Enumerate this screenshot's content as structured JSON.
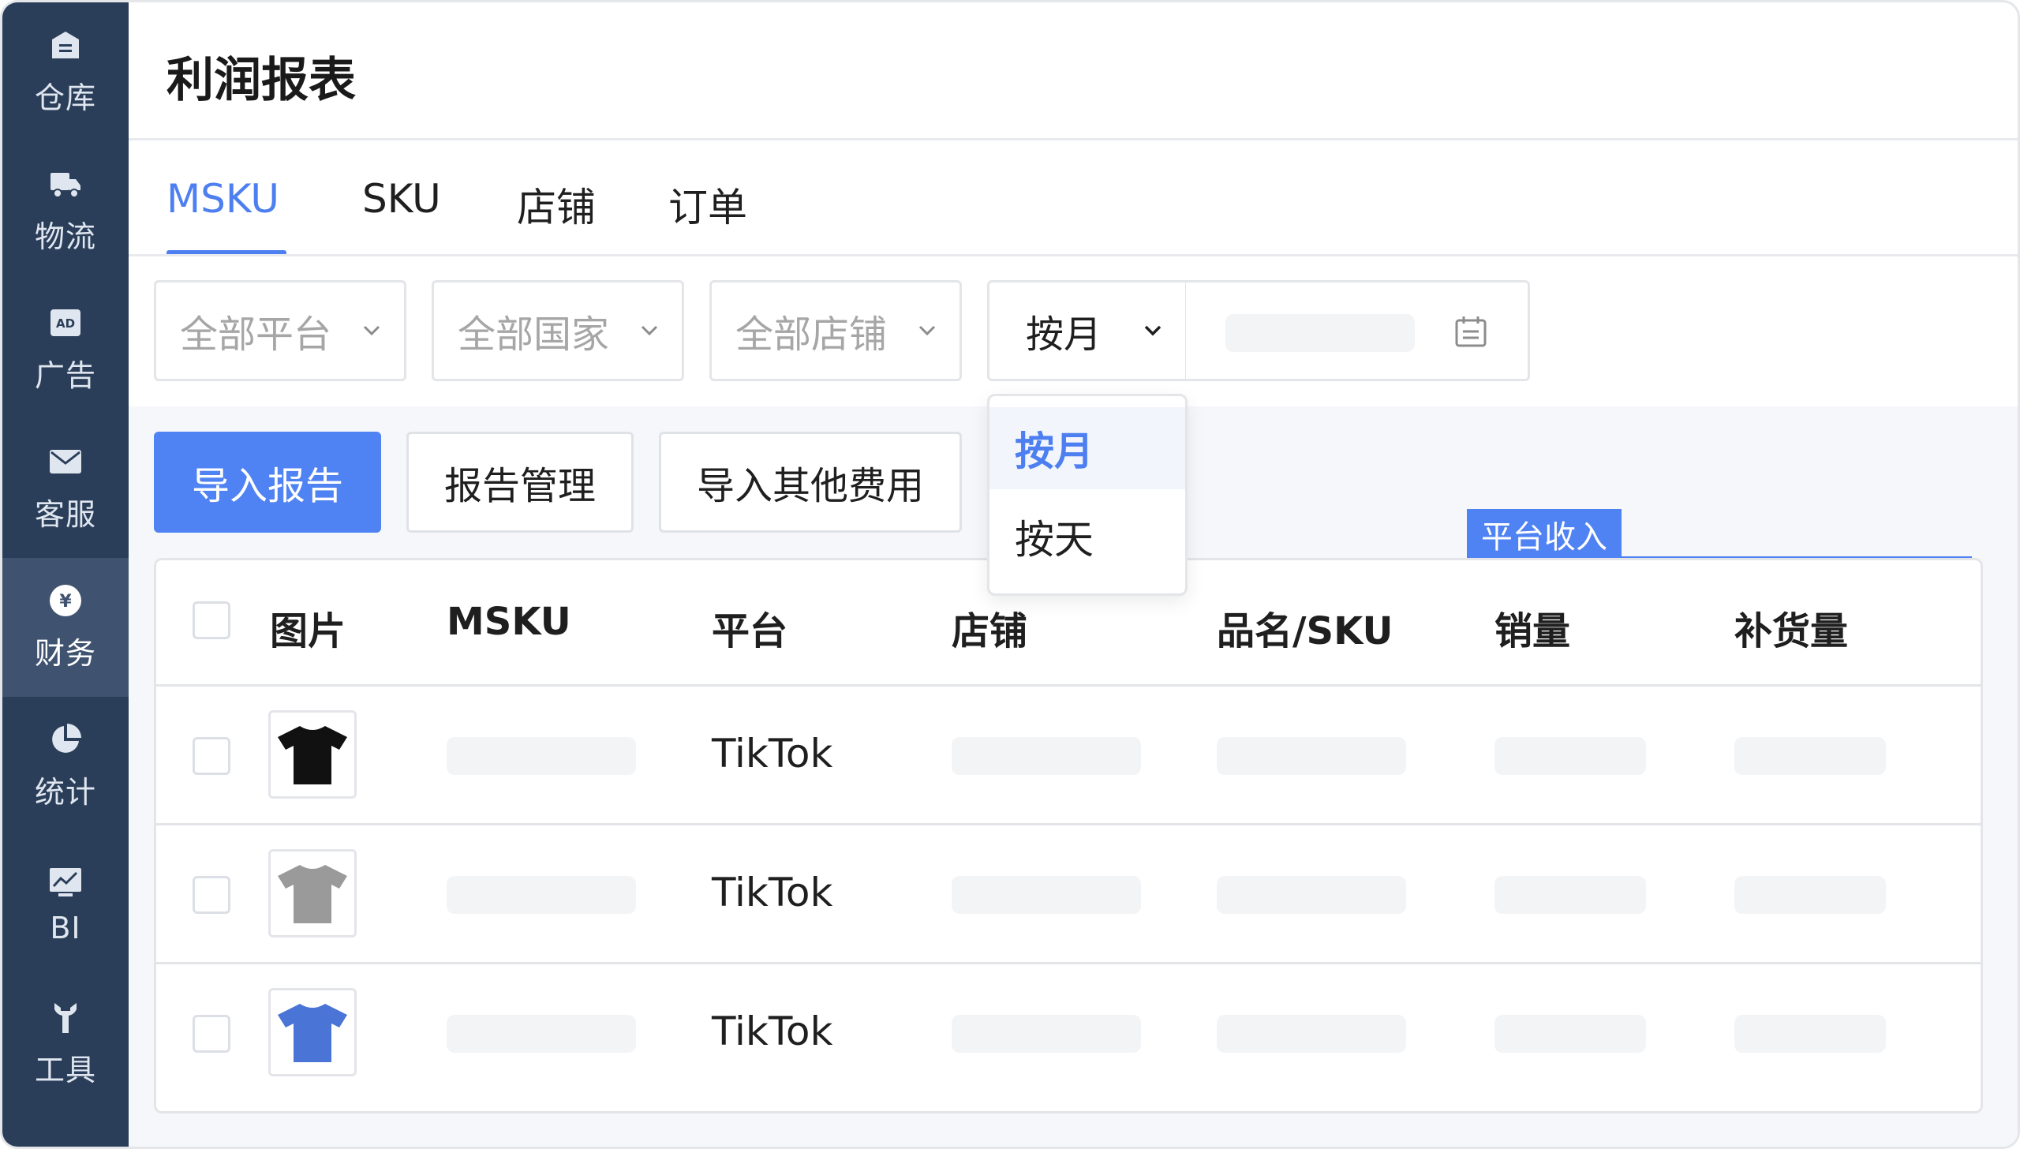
{
  "sidebar": {
    "items": [
      {
        "label": "仓库",
        "icon": "warehouse-icon"
      },
      {
        "label": "物流",
        "icon": "truck-icon"
      },
      {
        "label": "广告",
        "icon": "ad-icon"
      },
      {
        "label": "客服",
        "icon": "mail-icon"
      },
      {
        "label": "财务",
        "icon": "yen-icon"
      },
      {
        "label": "统计",
        "icon": "pie-chart-icon"
      },
      {
        "label": "BI",
        "icon": "bi-chart-icon"
      },
      {
        "label": "工具",
        "icon": "wrench-icon"
      }
    ],
    "active": "财务"
  },
  "page": {
    "title": "利润报表"
  },
  "tabs": [
    {
      "label": "MSKU",
      "active": true
    },
    {
      "label": "SKU"
    },
    {
      "label": "店铺"
    },
    {
      "label": "订单"
    }
  ],
  "filters": {
    "platform_placeholder": "全部平台",
    "country_placeholder": "全部国家",
    "store_placeholder": "全部店铺",
    "period_value": "按月"
  },
  "period_dropdown": {
    "options": [
      "按月",
      "按天"
    ],
    "selected": "按月"
  },
  "actions": {
    "import_report": "导入报告",
    "report_manage": "报告管理",
    "import_other_fees": "导入其他费用"
  },
  "column_group_tag": "平台收入",
  "table": {
    "headers": [
      "图片",
      "MSKU",
      "平台",
      "店铺",
      "品名/SKU",
      "销量",
      "补货量"
    ],
    "rows": [
      {
        "platform": "TikTok",
        "shirt_color": "#111111"
      },
      {
        "platform": "TikTok",
        "shirt_color": "#9a9a9a"
      },
      {
        "platform": "TikTok",
        "shirt_color": "#4a74d6"
      }
    ]
  },
  "colors": {
    "sidebar_bg": "#2b3e59",
    "sidebar_active": "#3f5370",
    "accent": "#4d7ff0"
  }
}
